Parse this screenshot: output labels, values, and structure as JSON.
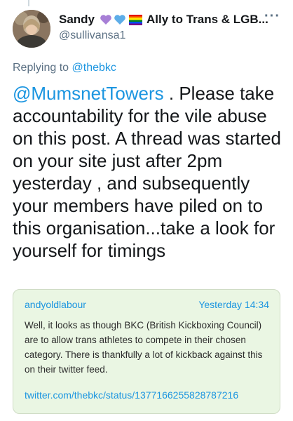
{
  "author": {
    "name": "Sandy",
    "bio": "Ally to Trans & LGB...",
    "handle": "@sullivansa1",
    "emoji_icons": [
      "purple-heart-icon",
      "blue-heart-icon",
      "rainbow-flag-icon"
    ],
    "more_icon": "more-options-icon"
  },
  "reply": {
    "prefix": "Replying to",
    "target": "@thebkc"
  },
  "tweet": {
    "mention": "@MumsnetTowers",
    "text": " .  Please take accountability for the vile abuse on this post.  A thread was started on your site just after 2pm yesterday  , and subsequently your members have piled on to this organisation...take a look for yourself for timings"
  },
  "quote": {
    "username": "andyoldlabour",
    "timestamp": "Yesterday 14:34",
    "body": "Well, it looks as though BKC (British Kickboxing Council) are to allow trans athletes to compete in their chosen category. There is thankfully a lot of kickback against this on their twitter feed.",
    "link": "twitter.com/thebkc/status/1377166255828787216"
  },
  "colors": {
    "link": "#1b95e0",
    "secondary_text": "#5b7083",
    "quote_background": "#eaf6e3"
  }
}
